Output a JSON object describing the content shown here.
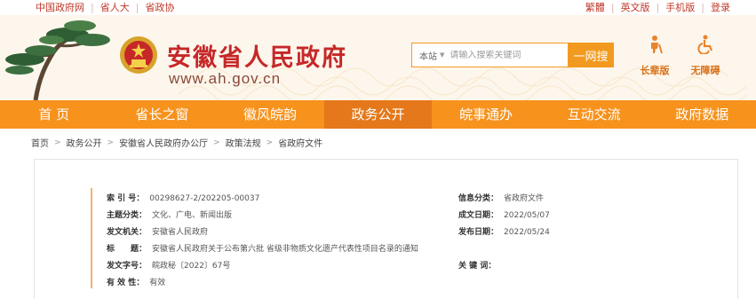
{
  "topbar": {
    "left_links": [
      "中国政府网",
      "省人大",
      "省政协"
    ],
    "right_links": [
      "繁體",
      "英文版",
      "手机版",
      "登录"
    ]
  },
  "header": {
    "site_title": "安徽省人民政府",
    "site_url": "www.ah.gov.cn",
    "search": {
      "scope": "本站",
      "placeholder": "请输入搜索关键词",
      "button": "一网搜"
    },
    "tools": {
      "elder": "长辈版",
      "accessible": "无障碍"
    }
  },
  "nav": {
    "items": [
      "首 页",
      "省长之窗",
      "徽风皖韵",
      "政务公开",
      "皖事通办",
      "互动交流",
      "政府数据"
    ],
    "active_index": 3
  },
  "breadcrumb": [
    "首页",
    "政务公开",
    "安徽省人民政府办公厅",
    "政策法规",
    "省政府文件"
  ],
  "doc_meta": {
    "index_label": "索 引 号：",
    "index_value": "00298627-2/202205-00037",
    "info_cat_label": "信息分类：",
    "info_cat_value": "省政府文件",
    "topic_label": "主题分类：",
    "topic_value": "文化、广电、新闻出版",
    "created_label": "成文日期：",
    "created_value": "2022/05/07",
    "issuer_label": "发文机关：",
    "issuer_value": "安徽省人民政府",
    "published_label": "发布日期：",
    "published_value": "2022/05/24",
    "title_label": "标　　题：",
    "title_value": "安徽省人民政府关于公布第六批 省级非物质文化遗产代表性项目名录的通知",
    "docno_label": "发文字号：",
    "docno_value": "皖政秘〔2022〕67号",
    "keywords_label": "关 键 词：",
    "keywords_value": "",
    "validity_label": "有 效 性：",
    "validity_value": "有效"
  },
  "colors": {
    "accent_orange": "#f7921d",
    "active_nav": "#e4781a",
    "title_red": "#c62828"
  }
}
